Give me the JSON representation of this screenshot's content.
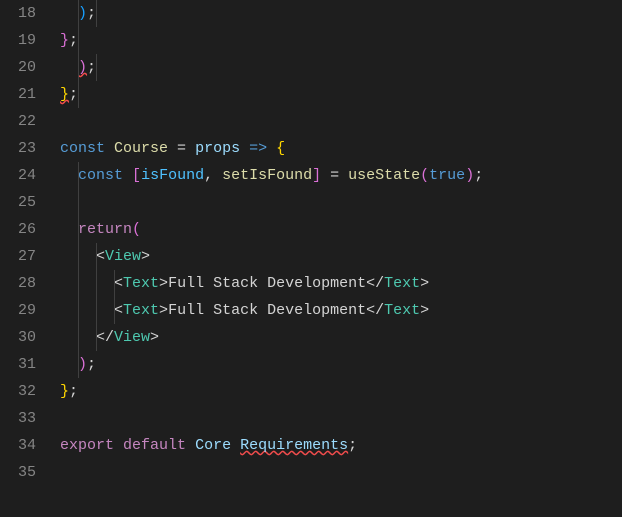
{
  "editor": {
    "lineStart": 18,
    "lines": {
      "18": [
        {
          "t": "  ",
          "c": "punc"
        },
        {
          "t": ")",
          "c": "paren-b"
        },
        {
          "t": ";",
          "c": "punc"
        }
      ],
      "19": [
        {
          "t": "}",
          "c": "paren-p"
        },
        {
          "t": ";",
          "c": "punc"
        }
      ],
      "20": [
        {
          "t": "  ",
          "c": "punc"
        },
        {
          "t": ")",
          "c": "paren-p err-underline"
        },
        {
          "t": ";",
          "c": "punc"
        }
      ],
      "21": [
        {
          "t": "}",
          "c": "paren-y err-underline"
        },
        {
          "t": ";",
          "c": "punc"
        }
      ],
      "22": [],
      "23": [
        {
          "t": "const",
          "c": "kw"
        },
        {
          "t": " ",
          "c": "punc"
        },
        {
          "t": "Course",
          "c": "fn"
        },
        {
          "t": " = ",
          "c": "punc"
        },
        {
          "t": "props",
          "c": "var"
        },
        {
          "t": " ",
          "c": "punc"
        },
        {
          "t": "=>",
          "c": "kw"
        },
        {
          "t": " ",
          "c": "punc"
        },
        {
          "t": "{",
          "c": "paren-y"
        }
      ],
      "24": [
        {
          "t": "  ",
          "c": "punc"
        },
        {
          "t": "const",
          "c": "kw"
        },
        {
          "t": " ",
          "c": "punc"
        },
        {
          "t": "[",
          "c": "paren-p"
        },
        {
          "t": "isFound",
          "c": "const-var"
        },
        {
          "t": ", ",
          "c": "punc"
        },
        {
          "t": "setIsFound",
          "c": "fn"
        },
        {
          "t": "]",
          "c": "paren-p"
        },
        {
          "t": " = ",
          "c": "punc"
        },
        {
          "t": "useState",
          "c": "fn"
        },
        {
          "t": "(",
          "c": "paren-p"
        },
        {
          "t": "true",
          "c": "bool"
        },
        {
          "t": ")",
          "c": "paren-p"
        },
        {
          "t": ";",
          "c": "punc"
        }
      ],
      "25": [],
      "26": [
        {
          "t": "  ",
          "c": "punc"
        },
        {
          "t": "return",
          "c": "kw2"
        },
        {
          "t": "(",
          "c": "paren-p"
        }
      ],
      "27": [
        {
          "t": "    ",
          "c": "punc"
        },
        {
          "t": "<",
          "c": "punc"
        },
        {
          "t": "View",
          "c": "type"
        },
        {
          "t": ">",
          "c": "punc"
        }
      ],
      "28": [
        {
          "t": "      ",
          "c": "punc"
        },
        {
          "t": "<",
          "c": "punc"
        },
        {
          "t": "Text",
          "c": "type"
        },
        {
          "t": ">",
          "c": "punc"
        },
        {
          "t": "Full Stack Development",
          "c": "str"
        },
        {
          "t": "</",
          "c": "punc"
        },
        {
          "t": "Text",
          "c": "type"
        },
        {
          "t": ">",
          "c": "punc"
        }
      ],
      "29": [
        {
          "t": "      ",
          "c": "punc"
        },
        {
          "t": "<",
          "c": "punc"
        },
        {
          "t": "Text",
          "c": "type"
        },
        {
          "t": ">",
          "c": "punc"
        },
        {
          "t": "Full Stack Development",
          "c": "str"
        },
        {
          "t": "</",
          "c": "punc"
        },
        {
          "t": "Text",
          "c": "type"
        },
        {
          "t": ">",
          "c": "punc"
        }
      ],
      "30": [
        {
          "t": "    ",
          "c": "punc"
        },
        {
          "t": "</",
          "c": "punc"
        },
        {
          "t": "View",
          "c": "type"
        },
        {
          "t": ">",
          "c": "punc"
        }
      ],
      "31": [
        {
          "t": "  ",
          "c": "punc"
        },
        {
          "t": ")",
          "c": "paren-p"
        },
        {
          "t": ";",
          "c": "punc"
        }
      ],
      "32": [
        {
          "t": "}",
          "c": "paren-y"
        },
        {
          "t": ";",
          "c": "punc"
        }
      ],
      "33": [],
      "34": [
        {
          "t": "export",
          "c": "kw2"
        },
        {
          "t": " ",
          "c": "punc"
        },
        {
          "t": "default",
          "c": "kw2"
        },
        {
          "t": " ",
          "c": "punc"
        },
        {
          "t": "Core",
          "c": "var"
        },
        {
          "t": " ",
          "c": "punc"
        },
        {
          "t": "Requirements",
          "c": "var err-underline"
        },
        {
          "t": ";",
          "c": "punc"
        }
      ],
      "35": []
    },
    "guides": {
      "18": [
        1,
        2
      ],
      "19": [
        1
      ],
      "20": [
        1,
        2
      ],
      "21": [
        1
      ],
      "24": [
        1
      ],
      "25": [
        1
      ],
      "26": [
        1
      ],
      "27": [
        1,
        2
      ],
      "28": [
        1,
        2,
        3
      ],
      "29": [
        1,
        2,
        3
      ],
      "30": [
        1,
        2
      ],
      "31": [
        1
      ]
    }
  }
}
